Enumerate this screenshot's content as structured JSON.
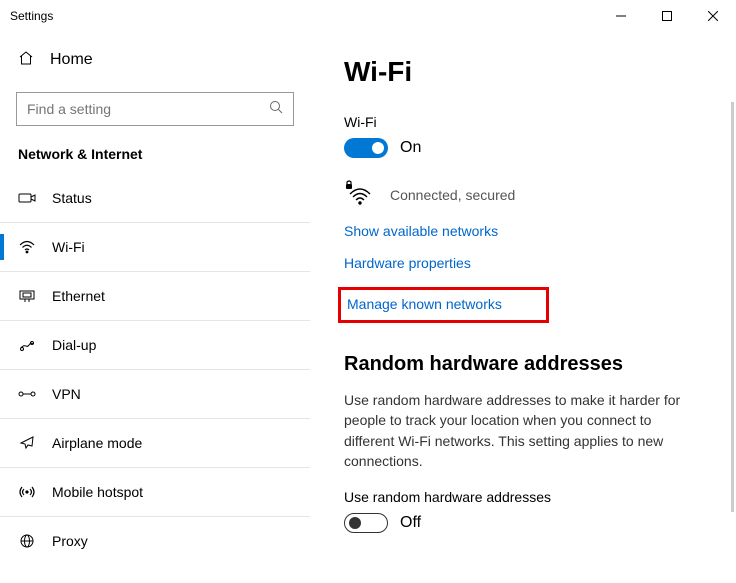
{
  "window": {
    "title": "Settings"
  },
  "sidebar": {
    "home": "Home",
    "search_placeholder": "Find a setting",
    "section": "Network & Internet",
    "items": [
      {
        "label": "Status"
      },
      {
        "label": "Wi-Fi"
      },
      {
        "label": "Ethernet"
      },
      {
        "label": "Dial-up"
      },
      {
        "label": "VPN"
      },
      {
        "label": "Airplane mode"
      },
      {
        "label": "Mobile hotspot"
      },
      {
        "label": "Proxy"
      }
    ]
  },
  "main": {
    "title": "Wi-Fi",
    "wifi_label": "Wi-Fi",
    "wifi_toggle_state": "On",
    "connection_status": "Connected, secured",
    "links": {
      "show_available": "Show available networks",
      "hardware_props": "Hardware properties",
      "manage_known": "Manage known networks"
    },
    "random": {
      "heading": "Random hardware addresses",
      "body": "Use random hardware addresses to make it harder for people to track your location when you connect to different Wi-Fi networks. This setting applies to new connections.",
      "toggle_label": "Use random hardware addresses",
      "toggle_state": "Off"
    }
  }
}
